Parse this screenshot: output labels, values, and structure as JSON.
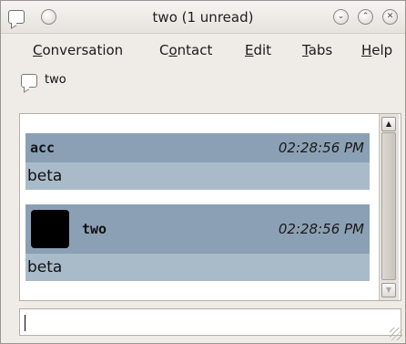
{
  "window": {
    "title": "two (1 unread)"
  },
  "titlebar_icons": [
    "chat-window-icon",
    "menu-circle-icon",
    "minimize-icon",
    "maximize-icon",
    "close-icon"
  ],
  "menu": [
    {
      "label": "Conversation",
      "mnemonic": "C",
      "rest": "onversation"
    },
    {
      "label": "Contact",
      "prefix": "C",
      "mnemonic": "o",
      "rest": "ntact"
    },
    {
      "label": "Edit",
      "mnemonic": "E",
      "rest": "dit"
    },
    {
      "label": "Tabs",
      "mnemonic": "T",
      "rest": "abs"
    },
    {
      "label": "Help",
      "mnemonic": "H",
      "rest": "elp"
    }
  ],
  "contact": {
    "name": "two"
  },
  "messages": [
    {
      "sender": "acc",
      "time": "02:28:56 PM",
      "text": "beta",
      "has_avatar": false
    },
    {
      "sender": "two",
      "time": "02:28:56 PM",
      "text": "beta",
      "has_avatar": true
    }
  ],
  "input": {
    "value": ""
  },
  "colors": {
    "header_bg": "#8ba0b4",
    "body_bg": "#a9bbc9",
    "window_bg": "#efebe7"
  }
}
